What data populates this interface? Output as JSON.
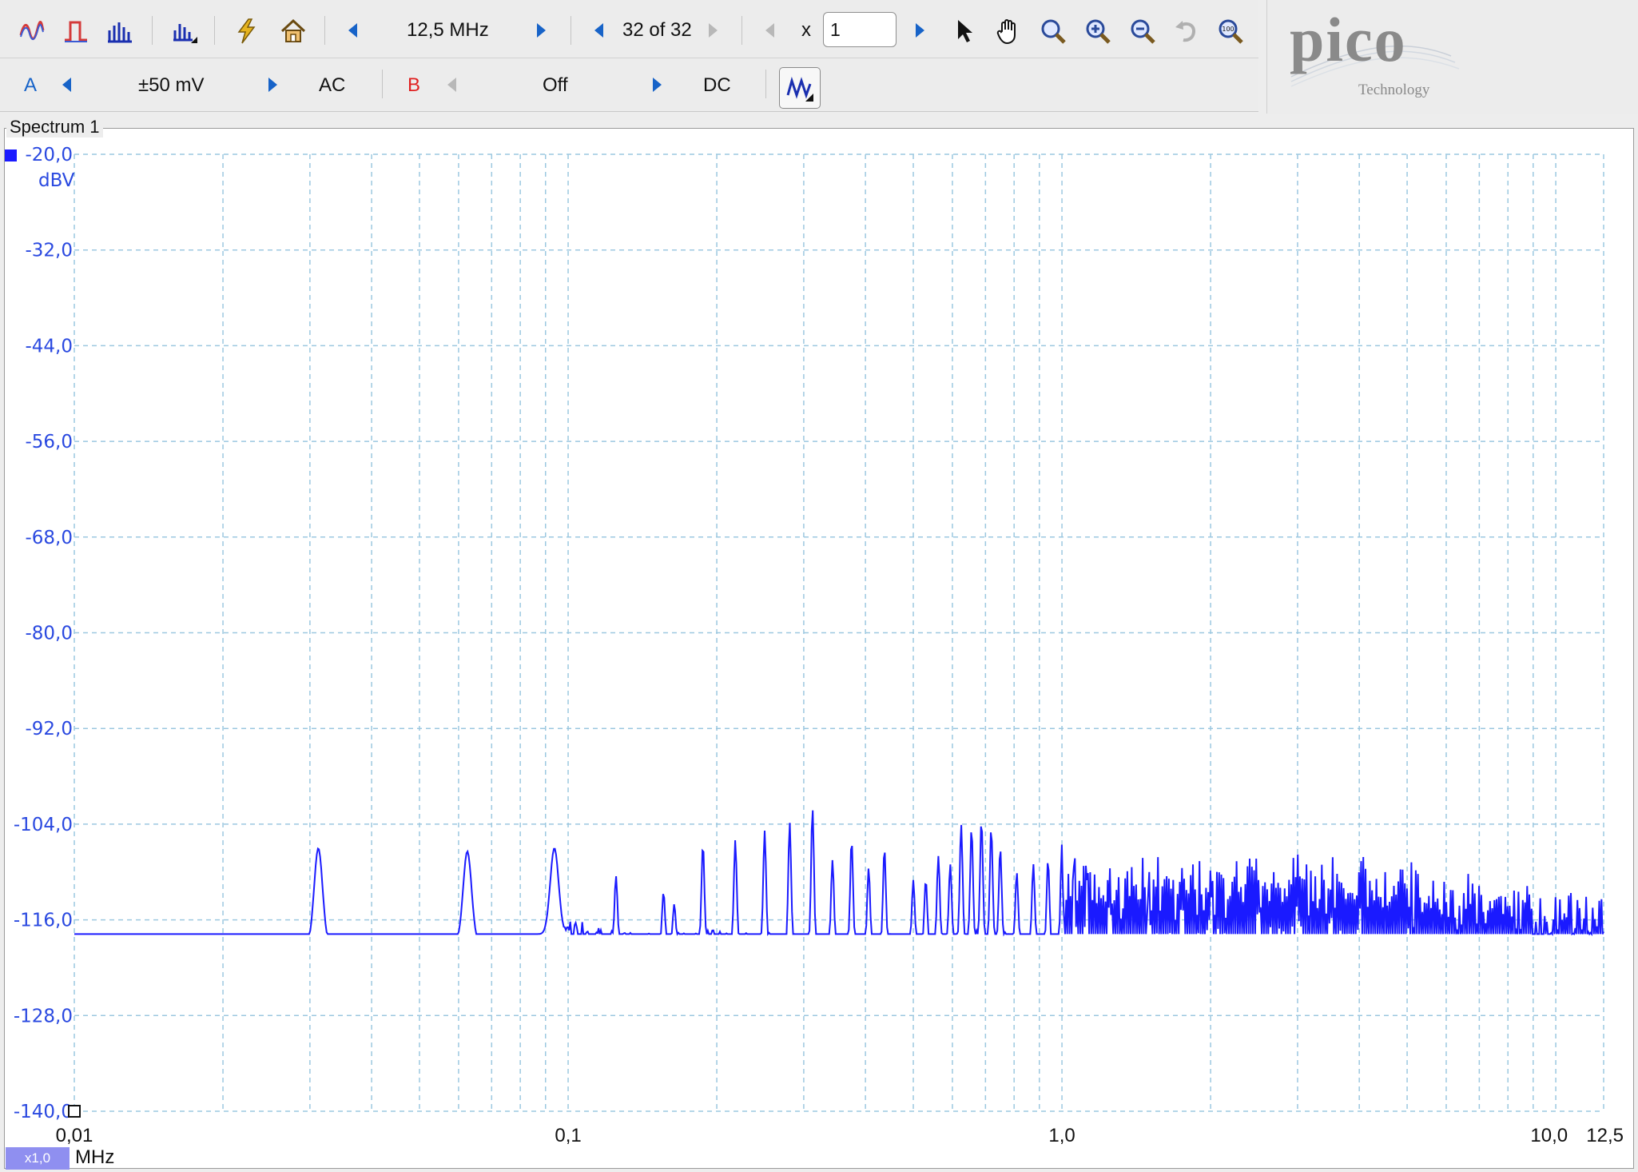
{
  "toolbar1": {
    "icons": [
      "scope-mode-icon",
      "persistence-mode-icon",
      "spectrum-mode-icon",
      "spectrum-options-icon",
      "trigger-icon",
      "home-icon"
    ],
    "timebase_value": "12,5 MHz",
    "buffer_value": "32 of 32",
    "zoom_label": "x",
    "zoom_value": "1",
    "tool_icons": [
      "pointer-icon",
      "hand-icon",
      "zoom-icon",
      "zoom-in-icon",
      "zoom-out-icon",
      "undo-zoom-icon",
      "zoom-100-icon"
    ]
  },
  "toolbar2": {
    "channel_a_label": "A",
    "channel_a_range": "±50 mV",
    "channel_a_coupling": "AC",
    "channel_b_label": "B",
    "channel_b_range": "Off",
    "channel_b_coupling": "DC",
    "view_icon": "view-options-icon"
  },
  "logo": {
    "name": "pico",
    "sub": "Technology"
  },
  "panel": {
    "title": "Spectrum 1"
  },
  "chart_data": {
    "type": "line",
    "title": "",
    "xscale": "log",
    "xlim": [
      0.01,
      12.5
    ],
    "ylim": [
      -140,
      -20
    ],
    "grid": true,
    "color": "#1a1aff",
    "y_unit": "dBV",
    "x_unit": "MHz",
    "x_scale_badge": "x1,0",
    "y_ticks": [
      "-20,0",
      "-32,0",
      "-44,0",
      "-56,0",
      "-68,0",
      "-80,0",
      "-92,0",
      "-104,0",
      "-116,0",
      "-128,0",
      "-140,0"
    ],
    "x_tick_labels": [
      {
        "value": 0.01,
        "label": "0,01"
      },
      {
        "value": 0.1,
        "label": "0,1"
      },
      {
        "value": 1.0,
        "label": "1,0"
      },
      {
        "value": 10.0,
        "label": "10,0"
      },
      {
        "value": 12.5,
        "label": "12,5"
      }
    ],
    "peaks": [
      {
        "x": 0.0312,
        "y": -107.0
      },
      {
        "x": 0.0625,
        "y": -107.4
      },
      {
        "x": 0.0938,
        "y": -107.0
      },
      {
        "x": 0.125,
        "y": -110.5
      },
      {
        "x": 0.156,
        "y": -112.5
      },
      {
        "x": 0.164,
        "y": -114.0
      },
      {
        "x": 0.1875,
        "y": -106.5
      },
      {
        "x": 0.218,
        "y": -106.0
      },
      {
        "x": 0.25,
        "y": -104.8
      },
      {
        "x": 0.281,
        "y": -103.8
      },
      {
        "x": 0.3125,
        "y": -102.0
      },
      {
        "x": 0.343,
        "y": -108.5
      },
      {
        "x": 0.375,
        "y": -106.0
      },
      {
        "x": 0.406,
        "y": -109.5
      },
      {
        "x": 0.437,
        "y": -107.0
      },
      {
        "x": 0.5,
        "y": -111.0
      },
      {
        "x": 0.53,
        "y": -111.0
      },
      {
        "x": 0.562,
        "y": -108.0
      },
      {
        "x": 0.594,
        "y": -109.0
      },
      {
        "x": 0.625,
        "y": -104.0
      },
      {
        "x": 0.656,
        "y": -104.5
      },
      {
        "x": 0.687,
        "y": -103.5
      },
      {
        "x": 0.719,
        "y": -104.5
      },
      {
        "x": 0.75,
        "y": -107.0
      },
      {
        "x": 0.81,
        "y": -110.0
      },
      {
        "x": 0.875,
        "y": -109.0
      },
      {
        "x": 0.937,
        "y": -108.5
      },
      {
        "x": 1.0,
        "y": -106.5
      },
      {
        "x": 1.06,
        "y": -106.5
      },
      {
        "x": 1.12,
        "y": -108.0
      },
      {
        "x": 1.25,
        "y": -109.5
      },
      {
        "x": 1.5,
        "y": -109.5
      },
      {
        "x": 1.75,
        "y": -109.5
      },
      {
        "x": 2.0,
        "y": -109.5
      },
      {
        "x": 2.5,
        "y": -111.0
      },
      {
        "x": 3.0,
        "y": -111.5
      },
      {
        "x": 3.5,
        "y": -113.0
      },
      {
        "x": 4.0,
        "y": -112.5
      },
      {
        "x": 5.0,
        "y": -114.5
      },
      {
        "x": 6.0,
        "y": -116.0
      }
    ],
    "noise_floor": [
      {
        "x": 0.01,
        "y": -121.5
      },
      {
        "x": 0.011,
        "y": -122.0
      },
      {
        "x": 0.013,
        "y": -120.8
      },
      {
        "x": 0.016,
        "y": -121.0
      },
      {
        "x": 0.02,
        "y": -120.5
      },
      {
        "x": 0.022,
        "y": -119.8
      },
      {
        "x": 0.025,
        "y": -120.8
      },
      {
        "x": 0.027,
        "y": -119.0
      },
      {
        "x": 0.035,
        "y": -119.5
      },
      {
        "x": 0.04,
        "y": -119.0
      },
      {
        "x": 0.045,
        "y": -119.5
      },
      {
        "x": 0.05,
        "y": -118.0
      },
      {
        "x": 0.055,
        "y": -119.5
      },
      {
        "x": 0.07,
        "y": -118.5
      },
      {
        "x": 0.08,
        "y": -119.5
      },
      {
        "x": 0.085,
        "y": -119.0
      },
      {
        "x": 0.1,
        "y": -117.0
      },
      {
        "x": 0.12,
        "y": -118.5
      },
      {
        "x": 0.14,
        "y": -119.0
      },
      {
        "x": 0.2,
        "y": -118.5
      },
      {
        "x": 0.3,
        "y": -119.0
      },
      {
        "x": 0.5,
        "y": -119.0
      },
      {
        "x": 0.7,
        "y": -118.5
      },
      {
        "x": 1.0,
        "y": -119.5
      },
      {
        "x": 1.5,
        "y": -119.5
      },
      {
        "x": 2.0,
        "y": -119.0
      },
      {
        "x": 3.0,
        "y": -118.5
      },
      {
        "x": 4.0,
        "y": -119.0
      },
      {
        "x": 5.0,
        "y": -120.0
      },
      {
        "x": 7.0,
        "y": -121.5
      },
      {
        "x": 10.0,
        "y": -122.5
      },
      {
        "x": 12.5,
        "y": -123.0
      }
    ]
  }
}
